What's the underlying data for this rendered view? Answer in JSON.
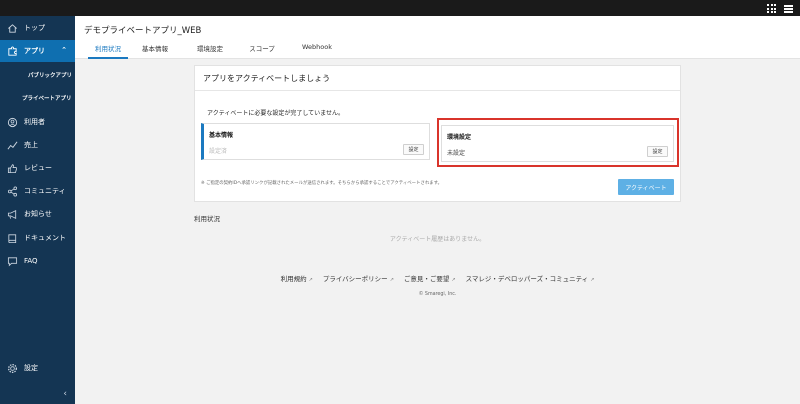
{
  "sidebar": {
    "items": [
      {
        "label": "トップ",
        "icon": "home-icon"
      },
      {
        "label": "アプリ",
        "icon": "puzzle-icon"
      },
      {
        "label": "利用者",
        "icon": "user-icon"
      },
      {
        "label": "売上",
        "icon": "chart-line-icon"
      },
      {
        "label": "レビュー",
        "icon": "thumbs-up-icon"
      },
      {
        "label": "コミュニティ",
        "icon": "share-icon"
      },
      {
        "label": "お知らせ",
        "icon": "megaphone-icon"
      },
      {
        "label": "ドキュメント",
        "icon": "book-icon"
      },
      {
        "label": "FAQ",
        "icon": "chat-icon"
      }
    ],
    "sub_items": [
      "パブリックアプリ",
      "プライベートアプリ"
    ],
    "settings_label": "設定",
    "collapse_glyph": "‹"
  },
  "header": {
    "title": "デモプライベートアプリ_WEB",
    "tabs": [
      "利用状況",
      "基本情報",
      "環境設定",
      "スコープ",
      "Webhook"
    ]
  },
  "card": {
    "title": "アプリをアクティベートしましょう",
    "message": "アクティベートに必要な設定が完了していません。",
    "basic": {
      "title": "基本情報",
      "value": "設定済",
      "button": "設定"
    },
    "env": {
      "title": "環境設定",
      "value": "未設定",
      "button": "設定"
    },
    "note": "※ ご指定の契約IDへ承認リンクが記載されたメールが送信されます。そちらから承認することでアクティベートされます。",
    "activate_button": "アクティベート"
  },
  "usage": {
    "title": "利用状況",
    "empty": "アクティベート履歴はありません。"
  },
  "footer": {
    "links": [
      "利用規約",
      "プライバシーポリシー",
      "ご意見・ご要望",
      "スマレジ・デベロッパーズ・コミュニティ"
    ],
    "external_glyph": "↗",
    "copyright": "© Smaregi, Inc."
  },
  "colors": {
    "sidebar_bg": "#143553",
    "accent": "#1b79c0",
    "activate_button": "#5eb0e5",
    "highlight": "#d9342b"
  }
}
